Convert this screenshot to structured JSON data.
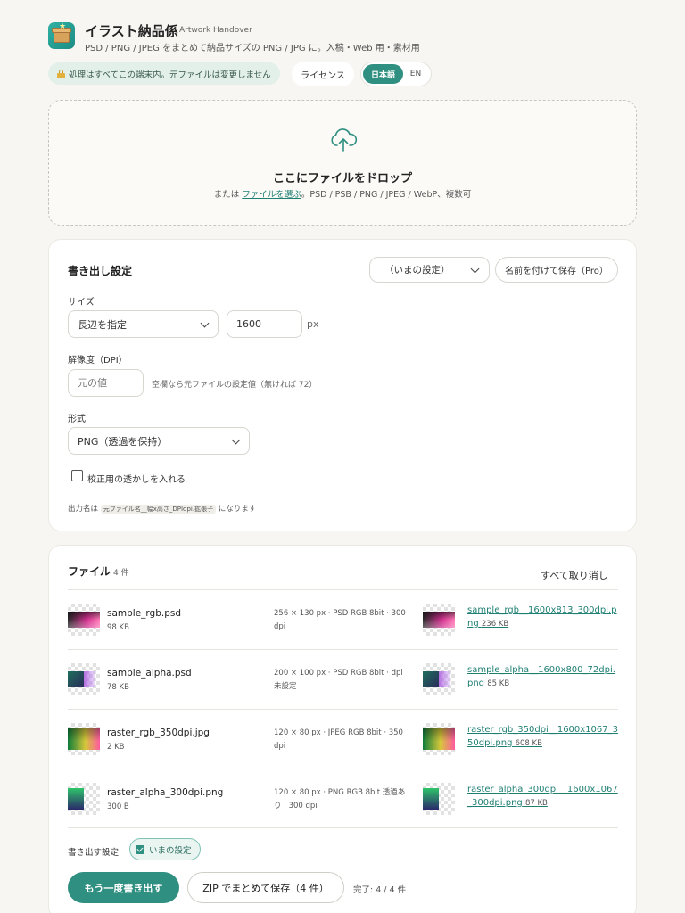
{
  "header": {
    "title": "イラスト納品係",
    "subtitle": "Artwork Handover",
    "description": "PSD / PNG / JPEG をまとめて納品サイズの PNG / JPG に。入稿・Web 用・素材用"
  },
  "notice": "処理はすべてこの端末内。元ファイルは変更しません",
  "license_label": "ライセンス",
  "lang": {
    "ja": "日本語",
    "en": "EN",
    "active": "ja"
  },
  "dropzone": {
    "title": "ここにファイルをドロップ",
    "prefix": "または",
    "link": "ファイルを選ぶ",
    "suffix": "。PSD / PSB / PNG / JPEG / WebP、複数可"
  },
  "export": {
    "title": "書き出し設定",
    "preset": "（いまの設定）",
    "save_named": "名前を付けて保存（Pro）",
    "size_label": "サイズ",
    "size_mode": "長辺を指定",
    "size_value": "1600",
    "size_unit": "px",
    "dpi_label": "解像度（DPI）",
    "dpi_placeholder": "元の値",
    "dpi_hint": "空欄なら元ファイルの設定値（無ければ 72）",
    "format_label": "形式",
    "format_value": "PNG（透過を保持）",
    "watermark_label": "校正用の透かしを入れる",
    "output_prefix": "出力名は",
    "output_pattern": "元ファイル名__幅x高さ_DPIdpi.拡張子",
    "output_suffix": "になります"
  },
  "files": {
    "title": "ファイル",
    "count": "4 件",
    "clear_all": "すべて取り消し",
    "items": [
      {
        "name": "sample_rgb.psd",
        "size": "98 KB",
        "meta": "256 × 130 px · PSD RGB 8bit · 300 dpi",
        "out_name": "sample_rgb__1600x813_300dpi.png",
        "out_size": "236 KB"
      },
      {
        "name": "sample_alpha.psd",
        "size": "78 KB",
        "meta": "200 × 100 px · PSD RGB 8bit · dpi 未設定",
        "out_name": "sample_alpha__1600x800_72dpi.png",
        "out_size": "85 KB"
      },
      {
        "name": "raster_rgb_350dpi.jpg",
        "size": "2 KB",
        "meta": "120 × 80 px · JPEG RGB 8bit · 350 dpi",
        "out_name": "raster_rgb_350dpi__1600x1067_350dpi.png",
        "out_size": "608 KB"
      },
      {
        "name": "raster_alpha_300dpi.png",
        "size": "300 B",
        "meta": "120 × 80 px · PNG RGB 8bit 透過あり · 300 dpi",
        "out_name": "raster_alpha_300dpi__1600x1067_300dpi.png",
        "out_size": "87 KB"
      }
    ],
    "export_setting_label": "書き出す設定",
    "current_setting_chip": "いまの設定",
    "rerun_label": "もう一度書き出す",
    "zip_label": "ZIP でまとめて保存（4 件）",
    "done_text": "完了: 4 / 4 件"
  },
  "colors": {
    "accent": "#2f8f80",
    "link": "#1f7f73",
    "background": "#f7f6f2"
  }
}
